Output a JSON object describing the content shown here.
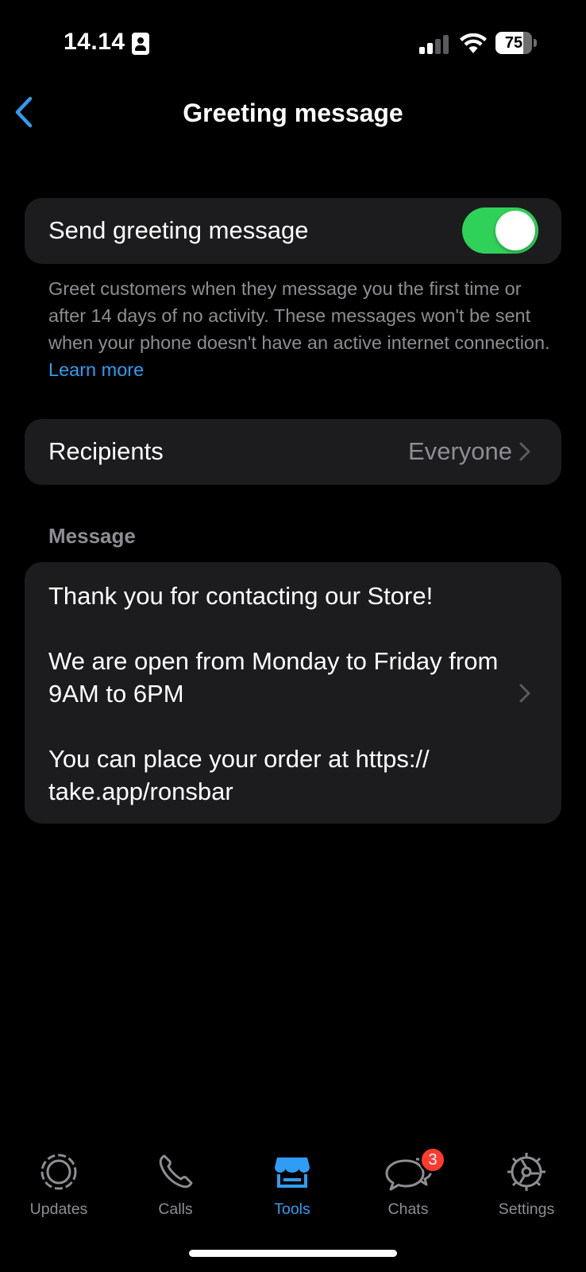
{
  "status_bar": {
    "time": "14.14",
    "battery_level": "75",
    "battery_fraction": 0.75
  },
  "nav": {
    "title": "Greeting message",
    "back_icon": "chevron-left-icon"
  },
  "toggle": {
    "label": "Send greeting message",
    "enabled": true,
    "on_color": "#30d158"
  },
  "description": {
    "text": "Greet customers when they message you the first time or after 14 days of no activity. These messages won't be sent when your phone doesn't have an active internet connection.",
    "link_label": "Learn more"
  },
  "recipients": {
    "label": "Recipients",
    "value": "Everyone"
  },
  "message_section": {
    "header": "Message",
    "paragraphs": [
      "Thank you for contacting our Store!",
      "We are open from Monday to Friday from 9AM to 6PM",
      "You can place your order at https:// take.app/ronsbar"
    ]
  },
  "tab_bar": {
    "tabs": [
      {
        "label": "Updates",
        "icon": "updates-icon",
        "active": false
      },
      {
        "label": "Calls",
        "icon": "phone-icon",
        "active": false
      },
      {
        "label": "Tools",
        "icon": "storefront-icon",
        "active": true
      },
      {
        "label": "Chats",
        "icon": "chat-bubbles-icon",
        "active": false,
        "badge": "3"
      },
      {
        "label": "Settings",
        "icon": "gear-icon",
        "active": false
      }
    ]
  },
  "colors": {
    "accent": "#2f9df4",
    "card": "#1c1c1e",
    "secondary_text": "#8d8d93",
    "badge": "#ff3b30"
  }
}
